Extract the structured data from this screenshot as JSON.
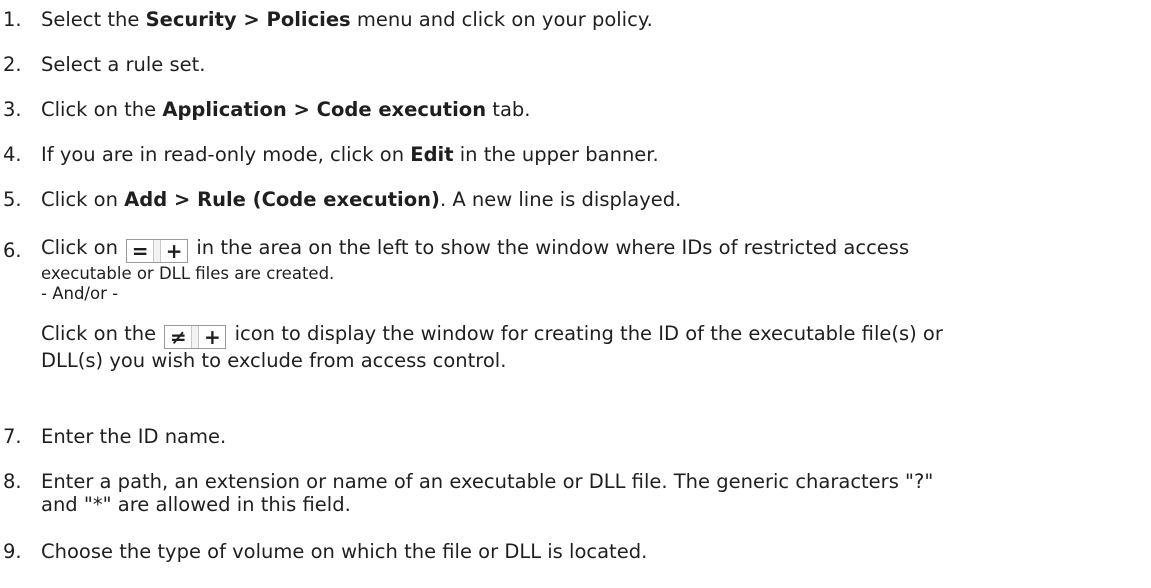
{
  "steps": [
    {
      "num": "1.",
      "a": "Select the ",
      "b1": "Security > Policies",
      "c": " menu and click on your policy."
    },
    {
      "num": "2.",
      "a": "Select a rule set."
    },
    {
      "num": "3.",
      "a": "Click on the ",
      "b1": "Application > Code execution",
      "c": " tab."
    },
    {
      "num": "4.",
      "a": "If you are in read-only mode, click on ",
      "b1": "Edit",
      "c": " in the upper banner."
    },
    {
      "num": "5.",
      "a": "Click on ",
      "b1": "Add > Rule (Code execution)",
      "c": ". A new line is displayed."
    },
    {
      "num": "6.",
      "a": "Click on",
      "icon1": "equals-plus-icon",
      "c1": "in the area on the left to show the window where IDs of restricted access",
      "c2": "executable or DLL files are created.",
      "andor": "- And/or -",
      "d": "Click on the",
      "icon2": "not-equals-plus-icon",
      "e1": "icon to display the window for creating the ID of the executable file(s) or",
      "e2": "DLL(s) you wish to exclude from access control."
    },
    {
      "num": "7.",
      "a": "Enter the ID name."
    },
    {
      "num": "8.",
      "a": "Enter a path, an extension or name of an executable or DLL file. The generic characters \"?\"",
      "a2": "and \"*\" are allowed in this field."
    },
    {
      "num": "9.",
      "a": "Choose the type of volume on which the file or DLL is located."
    }
  ],
  "icons": {
    "equals": "=",
    "not_equals": "≠",
    "plus": "+"
  }
}
